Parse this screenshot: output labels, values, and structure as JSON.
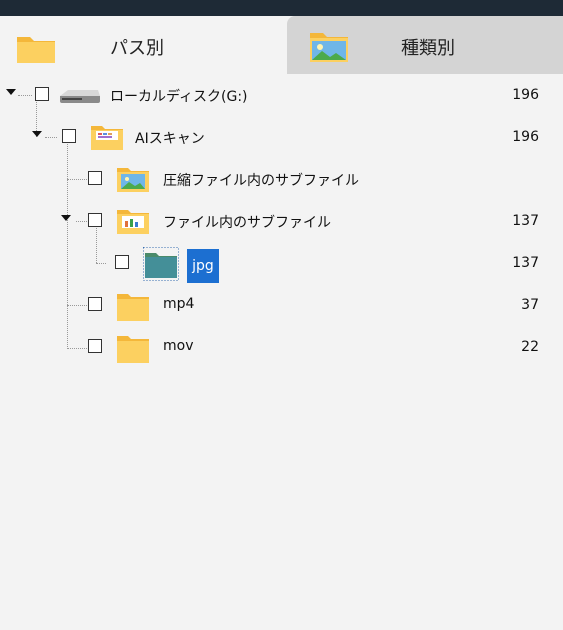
{
  "tabs": [
    {
      "label": "パス別",
      "icon": "folder-icon"
    },
    {
      "label": "種類別",
      "icon": "image-folder-icon"
    }
  ],
  "tree": {
    "drive": {
      "label": "ローカルディスク(G:)",
      "count": "196",
      "icon": "drive-icon"
    },
    "ai_scan": {
      "label": "AIスキャン",
      "count": "196",
      "icon": "ai-folder-icon"
    },
    "compressed": {
      "label": "圧縮ファイル内のサブファイル",
      "count": "",
      "icon": "image-folder-icon"
    },
    "in_file": {
      "label": "ファイル内のサブファイル",
      "count": "137",
      "icon": "chart-folder-icon"
    },
    "jpg": {
      "label": "jpg",
      "count": "137",
      "icon": "folder-icon"
    },
    "mp4": {
      "label": "mp4",
      "count": "37",
      "icon": "folder-icon"
    },
    "mov": {
      "label": "mov",
      "count": "22",
      "icon": "folder-icon"
    }
  },
  "colors": {
    "selection": "#1c6fd1",
    "folder": "#f8c44a",
    "topbar": "#1e2a36",
    "inactive_tab": "#d4d4d4"
  }
}
